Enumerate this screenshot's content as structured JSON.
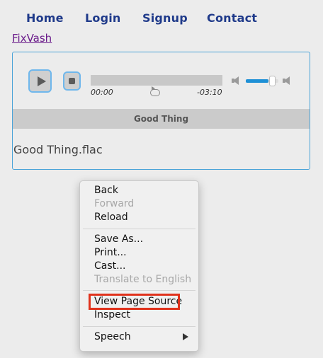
{
  "nav": {
    "items": [
      "Home",
      "Login",
      "Signup",
      "Contact"
    ]
  },
  "site_link": "FixVash",
  "player": {
    "current_time": "00:00",
    "remaining_time": "-03:10",
    "volume_level": 0.7,
    "track_title": "Good Thing",
    "file_name": "Good Thing.flac",
    "icons": [
      "play-icon",
      "stop-icon",
      "loop-icon",
      "mute-icon",
      "volume-max-icon"
    ],
    "accent_color": "#1e90d6"
  },
  "context_menu": {
    "back": "Back",
    "forward": "Forward",
    "reload": "Reload",
    "save_as": "Save As...",
    "print": "Print...",
    "cast": "Cast...",
    "translate": "Translate to English",
    "view_source": "View Page Source",
    "inspect": "Inspect",
    "speech": "Speech",
    "highlight_color": "#e0321c"
  }
}
